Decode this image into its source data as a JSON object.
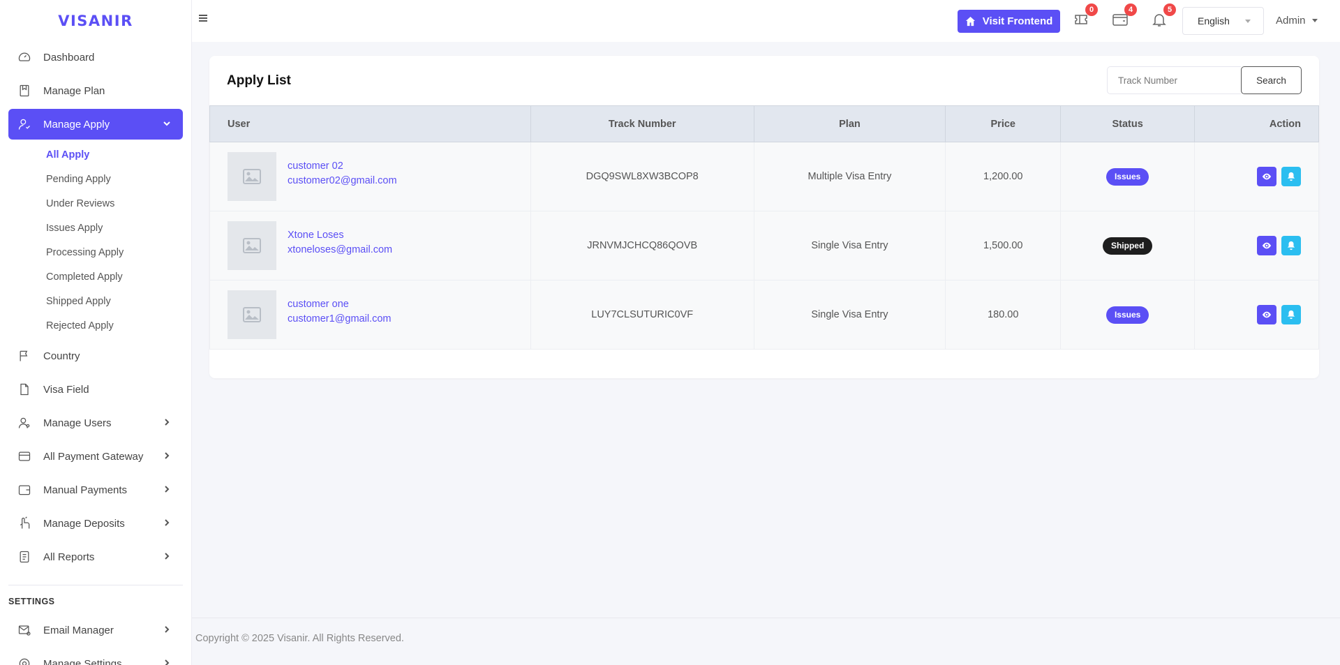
{
  "brand": {
    "name": "VISANIR",
    "color": "#5b4ff5"
  },
  "sidebar": {
    "items": [
      {
        "label": "Dashboard",
        "icon": "dashboard-icon",
        "has_children": false
      },
      {
        "label": "Manage Plan",
        "icon": "plan-icon",
        "has_children": false
      },
      {
        "label": "Manage Apply",
        "icon": "user-check-icon",
        "has_children": true,
        "active": true,
        "expanded": true
      },
      {
        "label": "Country",
        "icon": "flag-icon",
        "has_children": false
      },
      {
        "label": "Visa Field",
        "icon": "file-icon",
        "has_children": false
      },
      {
        "label": "Manage Users",
        "icon": "users-icon",
        "has_children": true
      },
      {
        "label": "All Payment Gateway",
        "icon": "credit-card-icon",
        "has_children": true
      },
      {
        "label": "Manual Payments",
        "icon": "wallet-icon",
        "has_children": true
      },
      {
        "label": "Manage Deposits",
        "icon": "hand-coin-icon",
        "has_children": true
      },
      {
        "label": "All Reports",
        "icon": "report-icon",
        "has_children": true
      }
    ],
    "submenu": [
      {
        "label": "All Apply",
        "active": true
      },
      {
        "label": "Pending Apply"
      },
      {
        "label": "Under Reviews"
      },
      {
        "label": "Issues Apply"
      },
      {
        "label": "Processing Apply"
      },
      {
        "label": "Completed Apply"
      },
      {
        "label": "Shipped Apply"
      },
      {
        "label": "Rejected Apply"
      }
    ],
    "settings_title": "SETTINGS",
    "settings_items": [
      {
        "label": "Email Manager",
        "icon": "mail-settings-icon",
        "has_children": true
      },
      {
        "label": "Manage Settings",
        "icon": "settings-icon",
        "has_children": true
      }
    ]
  },
  "header": {
    "visit_frontend": "Visit Frontend",
    "badges": {
      "tickets": "0",
      "wallet": "4",
      "notifications": "5"
    },
    "language": "English",
    "user": "Admin"
  },
  "card": {
    "title": "Apply List",
    "search_placeholder": "Track Number",
    "search_button": "Search"
  },
  "table": {
    "columns": [
      "User",
      "Track Number",
      "Plan",
      "Price",
      "Status",
      "Action"
    ],
    "rows": [
      {
        "name": "customer 02",
        "email": "customer02@gmail.com",
        "track": "DGQ9SWL8XW3BCOP8",
        "plan": "Multiple Visa Entry",
        "price": "1,200.00",
        "status": "Issues",
        "status_color": "#5b4ff5"
      },
      {
        "name": "Xtone Loses",
        "email": "xtoneloses@gmail.com",
        "track": "JRNVMJCHCQ86QOVB",
        "plan": "Single Visa Entry",
        "price": "1,500.00",
        "status": "Shipped",
        "status_color": "#1e1e1e"
      },
      {
        "name": "customer one",
        "email": "customer1@gmail.com",
        "track": "LUY7CLSUTURIC0VF",
        "plan": "Single Visa Entry",
        "price": "180.00",
        "status": "Issues",
        "status_color": "#5b4ff5"
      }
    ],
    "action_colors": {
      "view": "#5b4ff5",
      "notify": "#2bbef0"
    }
  },
  "footer": {
    "text": "Copyright © 2025 Visanir. All Rights Reserved."
  }
}
